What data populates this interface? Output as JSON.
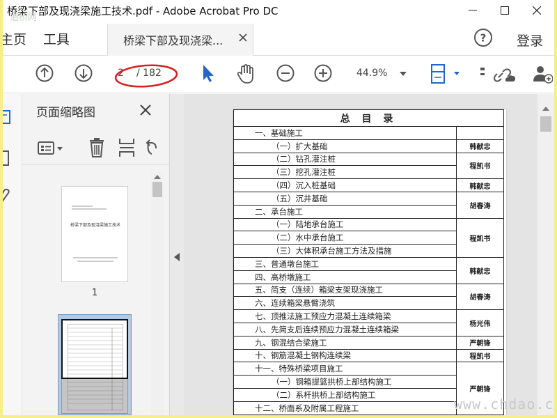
{
  "window": {
    "title": "桥梁下部及现浇梁施工技术.pdf - Adobe Acrobat Pro DC",
    "watermark_tl": "道桥网"
  },
  "tabbar": {
    "home": "主页",
    "tools": "工具",
    "doc_tab": "桥梁下部及现浇梁...",
    "login": "登录"
  },
  "toolbar": {
    "page_current": "2",
    "page_total": "/ 182",
    "zoom": "44.9%"
  },
  "thumbnails": {
    "title": "页面缩略图",
    "page1_title": "桥梁下部及现浇梁施工技术",
    "page1_label": "1"
  },
  "toc": {
    "heading": "总 目 录",
    "rows": [
      {
        "text": "一、基础施工",
        "level": "sec",
        "name": ""
      },
      {
        "text": "（一）扩大基础",
        "level": "sub",
        "name": "韩献忠"
      },
      {
        "text": "（二）钻孔灌注桩",
        "level": "sub",
        "name": "程凯书"
      },
      {
        "text": "（三）挖孔灌注桩",
        "level": "sub",
        "name": ""
      },
      {
        "text": "（四）沉入桩基础",
        "level": "sub",
        "name": "韩献忠"
      },
      {
        "text": "（五）沉井基础",
        "level": "sub",
        "name": "胡春涛"
      },
      {
        "text": "二、承台施工",
        "level": "sec",
        "name": ""
      },
      {
        "text": "（一）陆地承台施工",
        "level": "sub",
        "name": "程凯书"
      },
      {
        "text": "（二）水中承台施工",
        "level": "sub",
        "name": ""
      },
      {
        "text": "（三）大体积承台施工方法及措施",
        "level": "sub",
        "name": ""
      },
      {
        "text": "三、普通墩台施工",
        "level": "sec",
        "name": "韩献忠"
      },
      {
        "text": "四、高桥墩施工",
        "level": "sec",
        "name": ""
      },
      {
        "text": "五、简支（连续）箱梁支架现浇施工",
        "level": "sec",
        "name": "胡春涛"
      },
      {
        "text": "六、连续箱梁悬臂浇筑",
        "level": "sec",
        "name": ""
      },
      {
        "text": "七、顶推法施工预应力混凝土连续箱梁",
        "level": "sec",
        "name": "杨光伟"
      },
      {
        "text": "八、先简支后连续预应力混凝土连续箱梁",
        "level": "sec",
        "name": ""
      },
      {
        "text": "九、钢混结合梁施工",
        "level": "sec",
        "name": "严朝锋"
      },
      {
        "text": "十、钢筋混凝土钢构连续梁",
        "level": "sec",
        "name": "程凯书"
      },
      {
        "text": "十一、特殊桥梁项目施工",
        "level": "sec",
        "name": "严朝锋"
      },
      {
        "text": "（一）钢箱提篮拱桥上部结构施工",
        "level": "sub",
        "name": ""
      },
      {
        "text": "（二）系杆拱桥上部结构施工",
        "level": "sub",
        "name": ""
      },
      {
        "text": "十二、桥面系及附属工程施工",
        "level": "sec",
        "name": ""
      }
    ]
  },
  "page_watermark": "www.chdao.com",
  "colors": {
    "accent_blue": "#2266cc",
    "annotation_red": "#d81e1e",
    "frame_yellow": "#f6ee86"
  }
}
